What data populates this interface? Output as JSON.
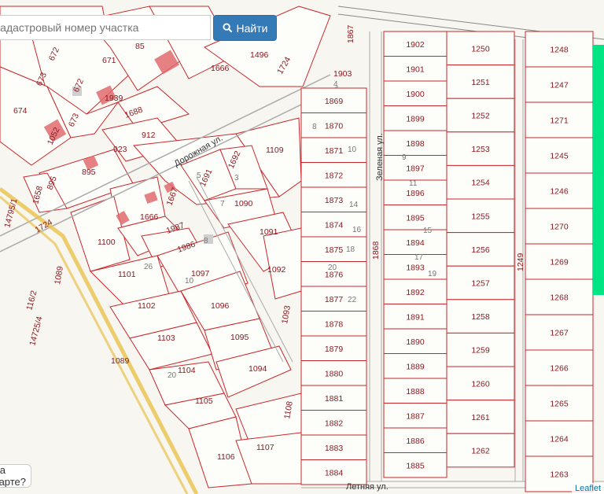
{
  "search": {
    "placeholder": "Кадастровый номер участка",
    "button_label": "Найти",
    "button_icon": "search-icon"
  },
  "help_text": "на карте?",
  "attribution": "Leaflet",
  "colors": {
    "boundary": "#c9272d",
    "button": "#337ab7",
    "highlight": "#00e584"
  },
  "roads": {
    "dorozhnaya": "Дорожная ул.",
    "zelenaya": "Зеленая ул.",
    "letnyaya": "Летняя ул."
  },
  "col1": [
    "1869",
    "1870",
    "1871",
    "1872",
    "1873",
    "1874",
    "1875",
    "1876",
    "1877",
    "1878",
    "1879",
    "1880",
    "1881",
    "1882",
    "1883",
    "1884"
  ],
  "col2": [
    "1902",
    "1901",
    "1900",
    "1899",
    "1898",
    "1897",
    "1896",
    "1895",
    "1894",
    "1893",
    "1892",
    "1891",
    "1890",
    "1889",
    "1888",
    "1887",
    "1886",
    "1885"
  ],
  "col3": [
    "1250",
    "1251",
    "1252",
    "1253",
    "1254",
    "1255",
    "1256",
    "1257",
    "1258",
    "1259",
    "1260",
    "1261",
    "1262"
  ],
  "col4": [
    "1248",
    "1247",
    "1271",
    "1245",
    "1246",
    "1270",
    "1269",
    "1268",
    "1267",
    "1266",
    "1265",
    "1264",
    "1263"
  ],
  "house_numbers": [
    "4",
    "8",
    "10",
    "9",
    "11",
    "14",
    "16",
    "15",
    "18",
    "17",
    "20",
    "19",
    "22",
    "5",
    "3",
    "7",
    "8",
    "26",
    "10",
    "20"
  ],
  "extra": [
    "1903",
    "1867",
    "1868",
    "1249"
  ],
  "left_labels": [
    {
      "t": "672"
    },
    {
      "t": "671"
    },
    {
      "t": "85"
    },
    {
      "t": "1496"
    },
    {
      "t": "1724"
    },
    {
      "t": "1666"
    },
    {
      "t": "673"
    },
    {
      "t": "672"
    },
    {
      "t": "1939"
    },
    {
      "t": "674"
    },
    {
      "t": "673"
    },
    {
      "t": "1052"
    },
    {
      "t": "1688"
    },
    {
      "t": "912"
    },
    {
      "t": "923"
    },
    {
      "t": "895"
    },
    {
      "t": "895"
    },
    {
      "t": "1658"
    },
    {
      "t": "1109"
    },
    {
      "t": "1692"
    },
    {
      "t": "1691"
    },
    {
      "t": "1090"
    },
    {
      "t": "1667"
    },
    {
      "t": "1666"
    },
    {
      "t": "1724"
    },
    {
      "t": "1100"
    },
    {
      "t": "1987"
    },
    {
      "t": "1986"
    },
    {
      "t": "1091"
    },
    {
      "t": "1092"
    },
    {
      "t": "1101"
    },
    {
      "t": "1097"
    },
    {
      "t": "1102"
    },
    {
      "t": "1096"
    },
    {
      "t": "1093"
    },
    {
      "t": "1103"
    },
    {
      "t": "1095"
    },
    {
      "t": "1089"
    },
    {
      "t": "1089"
    },
    {
      "t": "1104"
    },
    {
      "t": "1094"
    },
    {
      "t": "1105"
    },
    {
      "t": "1108"
    },
    {
      "t": "1106"
    },
    {
      "t": "1107"
    },
    {
      "t": "14795/1"
    },
    {
      "t": "116/2"
    },
    {
      "t": "14725/4"
    }
  ]
}
